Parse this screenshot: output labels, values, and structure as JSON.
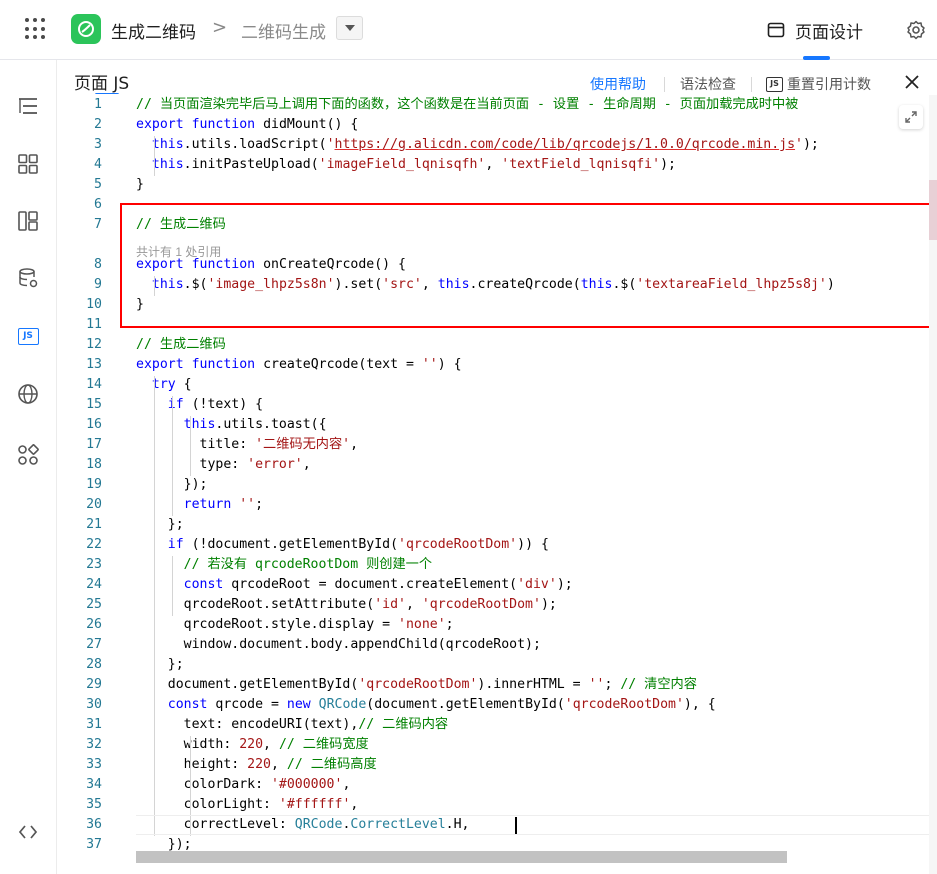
{
  "topbar": {
    "app_title": "生成二维码",
    "breadcrumb_sep": ">",
    "page_name": "二维码生成",
    "design_tab": "页面设计"
  },
  "panel": {
    "title": "页面 JS",
    "help": "使用帮助",
    "syntax_check": "语法检查",
    "js_badge": "JS",
    "reset_count": "重置引用计数",
    "codelens": "共计有 1 处引用"
  },
  "colors": {
    "accent": "#1677ff",
    "highlight_box": "#ff0000",
    "app_logo": "#2bc45a"
  },
  "sidebar": {
    "icons": [
      "outline-icon",
      "components-icon",
      "layout-icon",
      "datasource-icon",
      "js-icon",
      "globe-icon",
      "plugins-icon",
      "code-toggle-icon"
    ],
    "js_label": "JS"
  },
  "code": [
    {
      "n": "1",
      "segs": [
        [
          "cm",
          "// 当页面渲染完毕后马上调用下面的函数，这个函数是在当前页面 - 设置 - 生命周期 - 页面加载完成时中被"
        ]
      ]
    },
    {
      "n": "2",
      "segs": [
        [
          "kw",
          "export"
        ],
        [
          "",
          " "
        ],
        [
          "kw",
          "function"
        ],
        [
          "",
          " didMount() {"
        ]
      ]
    },
    {
      "n": "3",
      "segs": [
        [
          "",
          "  "
        ],
        [
          "th",
          "this"
        ],
        [
          "",
          ".utils.loadScript("
        ],
        [
          "st",
          "'"
        ],
        [
          "url",
          "https://g.alicdn.com/code/lib/qrcodejs/1.0.0/qrcode.min.js"
        ],
        [
          "st",
          "'"
        ],
        [
          "",
          ");"
        ]
      ]
    },
    {
      "n": "4",
      "segs": [
        [
          "",
          "  "
        ],
        [
          "th",
          "this"
        ],
        [
          "",
          ".initPasteUpload("
        ],
        [
          "st",
          "'imageField_lqnisqfh'"
        ],
        [
          "",
          ", "
        ],
        [
          "st",
          "'textField_lqnisqfi'"
        ],
        [
          "",
          ");"
        ]
      ]
    },
    {
      "n": "5",
      "segs": [
        [
          "",
          "}"
        ]
      ]
    },
    {
      "n": "6",
      "segs": []
    },
    {
      "n": "7",
      "segs": [
        [
          "cm",
          "// 生成二维码"
        ]
      ]
    },
    {
      "n": "8",
      "segs": [
        [
          "kw",
          "export"
        ],
        [
          "",
          " "
        ],
        [
          "kw",
          "function"
        ],
        [
          "",
          " onCreateQrcode() {"
        ]
      ]
    },
    {
      "n": "9",
      "segs": [
        [
          "",
          "  "
        ],
        [
          "th",
          "this"
        ],
        [
          "",
          ".$("
        ],
        [
          "st",
          "'image_lhpz5s8n'"
        ],
        [
          "",
          ").set("
        ],
        [
          "st",
          "'src'"
        ],
        [
          "",
          ", "
        ],
        [
          "th",
          "this"
        ],
        [
          "",
          ".createQrcode("
        ],
        [
          "th",
          "this"
        ],
        [
          "",
          ".$("
        ],
        [
          "st",
          "'textareaField_lhpz5s8j'"
        ],
        [
          "",
          ")"
        ]
      ]
    },
    {
      "n": "10",
      "segs": [
        [
          "",
          "}"
        ]
      ]
    },
    {
      "n": "11",
      "segs": []
    },
    {
      "n": "12",
      "segs": [
        [
          "cm",
          "// 生成二维码"
        ]
      ]
    },
    {
      "n": "13",
      "segs": [
        [
          "kw",
          "export"
        ],
        [
          "",
          " "
        ],
        [
          "kw",
          "function"
        ],
        [
          "",
          " createQrcode(text = "
        ],
        [
          "st",
          "''"
        ],
        [
          "",
          ") {"
        ]
      ]
    },
    {
      "n": "14",
      "segs": [
        [
          "",
          "  "
        ],
        [
          "kw",
          "try"
        ],
        [
          "",
          " {"
        ]
      ]
    },
    {
      "n": "15",
      "segs": [
        [
          "",
          "    "
        ],
        [
          "kw",
          "if"
        ],
        [
          "",
          " (!text) {"
        ]
      ]
    },
    {
      "n": "16",
      "segs": [
        [
          "",
          "      "
        ],
        [
          "th",
          "this"
        ],
        [
          "",
          ".utils.toast({"
        ]
      ]
    },
    {
      "n": "17",
      "segs": [
        [
          "",
          "        title: "
        ],
        [
          "st",
          "'二维码无内容'"
        ],
        [
          "",
          ","
        ]
      ]
    },
    {
      "n": "18",
      "segs": [
        [
          "",
          "        type: "
        ],
        [
          "st",
          "'error'"
        ],
        [
          "",
          ","
        ]
      ]
    },
    {
      "n": "19",
      "segs": [
        [
          "",
          "      });"
        ]
      ]
    },
    {
      "n": "20",
      "segs": [
        [
          "",
          "      "
        ],
        [
          "kw",
          "return"
        ],
        [
          "",
          " "
        ],
        [
          "st",
          "''"
        ],
        [
          "",
          ";"
        ]
      ]
    },
    {
      "n": "21",
      "segs": [
        [
          "",
          "    };"
        ]
      ]
    },
    {
      "n": "22",
      "segs": [
        [
          "",
          "    "
        ],
        [
          "kw",
          "if"
        ],
        [
          "",
          " (!document.getElementById("
        ],
        [
          "st",
          "'qrcodeRootDom'"
        ],
        [
          "",
          ")) {"
        ]
      ]
    },
    {
      "n": "23",
      "segs": [
        [
          "",
          "      "
        ],
        [
          "cm",
          "// 若没有 qrcodeRootDom 则创建一个"
        ]
      ]
    },
    {
      "n": "24",
      "segs": [
        [
          "",
          "      "
        ],
        [
          "kw",
          "const"
        ],
        [
          "",
          " qrcodeRoot = document.createElement("
        ],
        [
          "st",
          "'div'"
        ],
        [
          "",
          ");"
        ]
      ]
    },
    {
      "n": "25",
      "segs": [
        [
          "",
          "      qrcodeRoot.setAttribute("
        ],
        [
          "st",
          "'id'"
        ],
        [
          "",
          ", "
        ],
        [
          "st",
          "'qrcodeRootDom'"
        ],
        [
          "",
          ");"
        ]
      ]
    },
    {
      "n": "26",
      "segs": [
        [
          "",
          "      qrcodeRoot.style.display = "
        ],
        [
          "st",
          "'none'"
        ],
        [
          "",
          ";"
        ]
      ]
    },
    {
      "n": "27",
      "segs": [
        [
          "",
          "      window.document.body.appendChild(qrcodeRoot);"
        ]
      ]
    },
    {
      "n": "28",
      "segs": [
        [
          "",
          "    };"
        ]
      ]
    },
    {
      "n": "29",
      "segs": [
        [
          "",
          "    document.getElementById("
        ],
        [
          "st",
          "'qrcodeRootDom'"
        ],
        [
          "",
          ").innerHTML = "
        ],
        [
          "st",
          "''"
        ],
        [
          "",
          "; "
        ],
        [
          "cm",
          "// 清空内容"
        ]
      ]
    },
    {
      "n": "30",
      "segs": [
        [
          "",
          "    "
        ],
        [
          "kw",
          "const"
        ],
        [
          "",
          " qrcode = "
        ],
        [
          "kw",
          "new"
        ],
        [
          "",
          " "
        ],
        [
          "cls",
          "QRCode"
        ],
        [
          "",
          "(document.getElementById("
        ],
        [
          "st",
          "'qrcodeRootDom'"
        ],
        [
          "",
          "), {"
        ]
      ]
    },
    {
      "n": "31",
      "segs": [
        [
          "",
          "      text: encodeURI(text),"
        ],
        [
          "cm",
          "// 二维码内容"
        ]
      ]
    },
    {
      "n": "32",
      "segs": [
        [
          "",
          "      width: "
        ],
        [
          "st",
          "220"
        ],
        [
          "",
          ", "
        ],
        [
          "cm",
          "// 二维码宽度"
        ]
      ]
    },
    {
      "n": "33",
      "segs": [
        [
          "",
          "      height: "
        ],
        [
          "st",
          "220"
        ],
        [
          "",
          ", "
        ],
        [
          "cm",
          "// 二维码高度"
        ]
      ]
    },
    {
      "n": "34",
      "segs": [
        [
          "",
          "      colorDark: "
        ],
        [
          "st",
          "'#000000'"
        ],
        [
          "",
          ","
        ]
      ]
    },
    {
      "n": "35",
      "segs": [
        [
          "",
          "      colorLight: "
        ],
        [
          "st",
          "'#ffffff'"
        ],
        [
          "",
          ","
        ]
      ]
    },
    {
      "n": "36",
      "segs": [
        [
          "",
          "      correctLevel: "
        ],
        [
          "cls",
          "QRCode"
        ],
        [
          "",
          "."
        ],
        [
          "cls",
          "CorrectLevel"
        ],
        [
          "",
          ".H,"
        ]
      ]
    },
    {
      "n": "37",
      "segs": [
        [
          "",
          "    });"
        ]
      ]
    }
  ]
}
